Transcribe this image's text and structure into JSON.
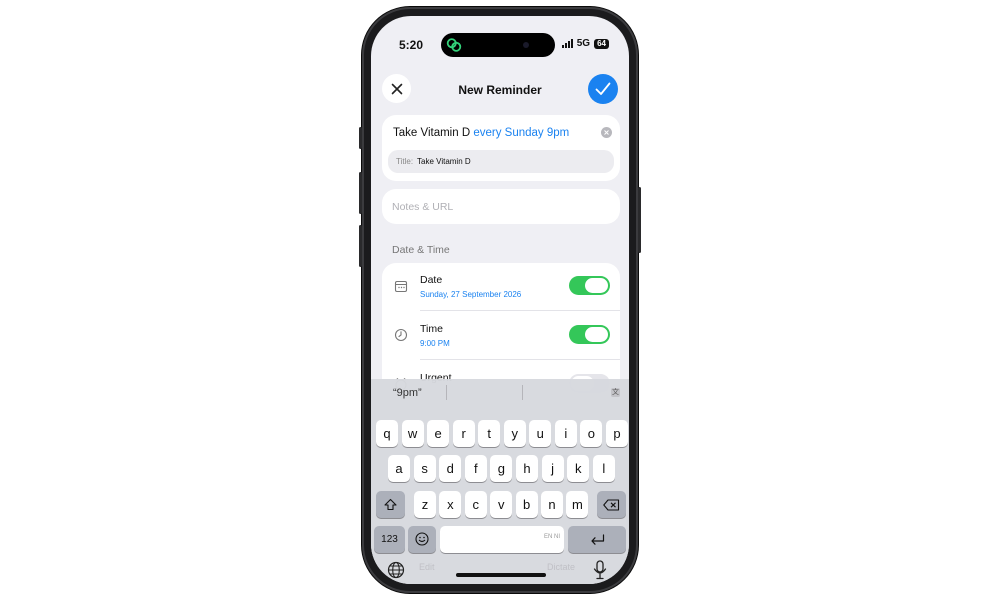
{
  "status": {
    "time": "5:20",
    "network": "5G",
    "battery": "64"
  },
  "sheet": {
    "title": "New Reminder"
  },
  "input": {
    "text": "Take Vitamin D",
    "highlight": "every Sunday 9pm"
  },
  "title_chip": {
    "label": "Title:",
    "value": "Take Vitamin D"
  },
  "notes": {
    "placeholder": "Notes & URL"
  },
  "section": {
    "date_time": "Date & Time"
  },
  "rows": {
    "date": {
      "title": "Date",
      "value": "Sunday, 27 September 2026",
      "enabled": true
    },
    "time": {
      "title": "Time",
      "value": "9:00 PM",
      "enabled": true
    },
    "urgent": {
      "title": "Urgent",
      "enabled": false
    }
  },
  "keyboard": {
    "suggestion": "“9pm”",
    "row1": [
      "q",
      "w",
      "e",
      "r",
      "t",
      "y",
      "u",
      "i",
      "o",
      "p"
    ],
    "row2": [
      "a",
      "s",
      "d",
      "f",
      "g",
      "h",
      "j",
      "k",
      "l"
    ],
    "row3": [
      "z",
      "x",
      "c",
      "v",
      "b",
      "n",
      "m"
    ],
    "numbers_label": "123",
    "space_hint": "EN NI",
    "ghost_left": "Edit",
    "ghost_right": "Dictate"
  },
  "colors": {
    "accent": "#1a82f0",
    "toggle_on": "#34c759",
    "background": "#efeff4"
  }
}
